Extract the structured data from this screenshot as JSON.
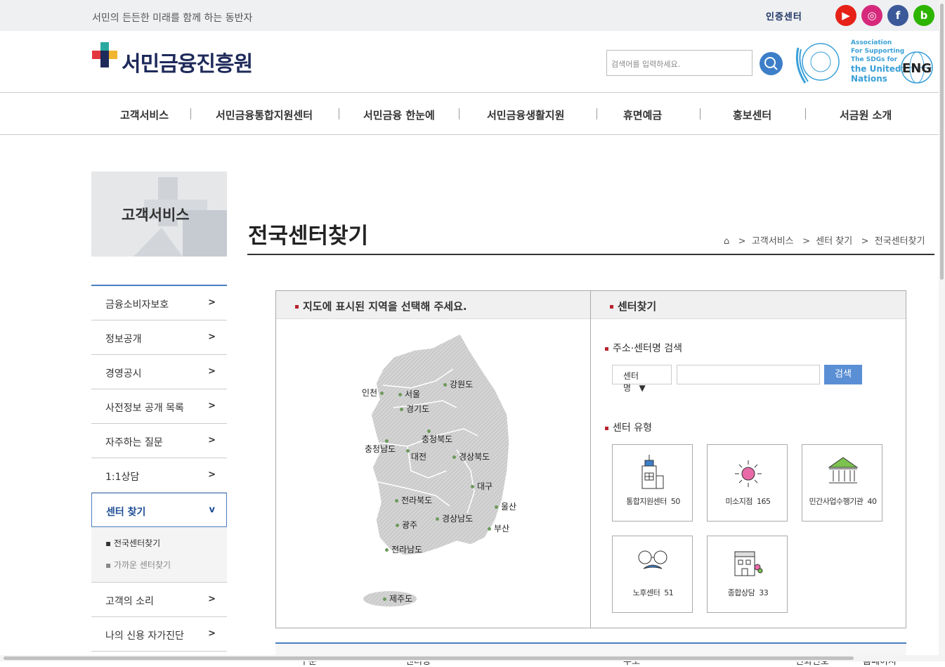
{
  "topbar": {
    "slogan": "서민의 든든한 미래를 함께 하는 동반자",
    "cert_label": "인증센터",
    "social": [
      {
        "name": "youtube",
        "color": "#e62117",
        "glyph": "▶"
      },
      {
        "name": "instagram",
        "color": "#d6297c",
        "glyph": "◎"
      },
      {
        "name": "facebook",
        "color": "#3b5998",
        "glyph": "f"
      },
      {
        "name": "blog",
        "color": "#2db400",
        "glyph": "b"
      }
    ]
  },
  "header": {
    "logo_text": "서민금융진흥원",
    "search_placeholder": "검색어를 입력하세요.",
    "sdg_lines": [
      "Association",
      "For Supporting",
      "The SDGs for",
      "the United",
      "Nations"
    ],
    "eng_label": "ENG"
  },
  "gnb": [
    "고객서비스",
    "서민금융통합지원센터",
    "서민금융 한눈에",
    "서민금융생활지원",
    "휴면예금",
    "홍보센터",
    "서금원 소개"
  ],
  "lnb": {
    "title": "고객서비스",
    "items": [
      {
        "label": "금융소비자보호",
        "arrow": ">"
      },
      {
        "label": "정보공개",
        "arrow": ">"
      },
      {
        "label": "경영공시",
        "arrow": ">"
      },
      {
        "label": "사전정보 공개 목록",
        "arrow": ">"
      },
      {
        "label": "자주하는 질문",
        "arrow": ">"
      },
      {
        "label": "1:1상담",
        "arrow": ">"
      }
    ],
    "active": {
      "label": "센터 찾기",
      "arrow": "v"
    },
    "sub": [
      "전국센터찾기",
      "가까운 센터찾기"
    ],
    "after": [
      {
        "label": "고객의 소리",
        "arrow": ">"
      },
      {
        "label": "나의 신용 자가진단",
        "arrow": ">"
      }
    ]
  },
  "page": {
    "title": "전국센터찾기",
    "breadcrumb": [
      "고객서비스",
      "센터 찾기",
      "전국센터찾기"
    ],
    "sep": ">"
  },
  "map_panel": {
    "heading": "지도에 표시된 지역을 선택해 주세요.",
    "regions": [
      "인천",
      "서울",
      "강원도",
      "경기도",
      "충청북도",
      "충청남도",
      "대전",
      "경상북도",
      "대구",
      "전라북도",
      "울산",
      "광주",
      "경상남도",
      "부산",
      "전라남도",
      "제주도"
    ]
  },
  "finder": {
    "heading": "센터찾기",
    "search_label": "주소·센터명 검색",
    "select_value": "센터명",
    "select_arrow": "▼",
    "search_button": "검색",
    "type_label": "센터 유형",
    "types": [
      {
        "label": "통합지원센터",
        "count": "50"
      },
      {
        "label": "미소지점",
        "count": "165"
      },
      {
        "label": "민간사업수행기관",
        "count": "40"
      },
      {
        "label": "노후센터",
        "count": "51"
      },
      {
        "label": "종합상담",
        "count": "33"
      }
    ]
  },
  "table": {
    "headers": [
      "구분",
      "센터명",
      "주소",
      "전화번호",
      "홈페이지"
    ]
  },
  "colors": {
    "accent": "#4a7ec0",
    "brand": "#1e2a5a",
    "bullet": "#b8232e"
  }
}
